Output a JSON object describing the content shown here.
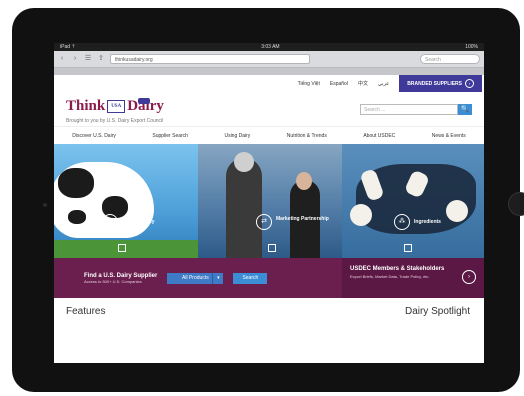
{
  "statusbar": {
    "left": "iPad ⇡",
    "time": "3:03 AM",
    "right": "100%"
  },
  "browser": {
    "url": "thinkusadairy.org",
    "search_placeholder": "Search"
  },
  "utility": {
    "links": [
      "Tiếng Việt",
      "Español",
      "中文",
      "عربي"
    ],
    "cta": "BRANDED SUPPLIERS"
  },
  "logo": {
    "think": "Think",
    "usa": "USA",
    "dairy": "Dairy",
    "tagline": "Brought to you by U.S. Dairy Export Council"
  },
  "sitesearch": {
    "placeholder": "Search ...",
    "button": "🔍"
  },
  "nav": [
    "Discover U.S. Dairy",
    "Supplier Search",
    "Using Dairy",
    "Nutrition & Trends",
    "About USDEC",
    "News & Events"
  ],
  "hero": [
    {
      "label": "Sustainability"
    },
    {
      "label": "Marketing Partnership"
    },
    {
      "label": "Ingredients"
    }
  ],
  "strip": {
    "finder_title": "Find a U.S. Dairy Supplier",
    "finder_sub": "Access to 500+ U.S. Companies",
    "select_value": "All Products",
    "search_btn": "Search",
    "members_title": "USDEC Members & Stakeholders",
    "members_sub": "Export Briefs, Market Data, Trade Policy, etc."
  },
  "lower": {
    "features": "Features",
    "spotlight": "Dairy Spotlight"
  }
}
